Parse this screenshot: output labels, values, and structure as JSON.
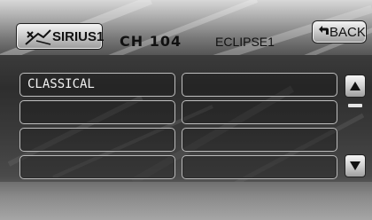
{
  "header": {
    "source_button": {
      "label": "SIRIUS1",
      "icon": "sirius-logo-icon"
    },
    "channel": "CH 104",
    "station_name": "ECLIPSE1",
    "back_button": {
      "label": "BACK",
      "icon": "return-arrow-icon"
    }
  },
  "presets": {
    "items": [
      {
        "label": "CLASSICAL"
      },
      {
        "label": ""
      },
      {
        "label": ""
      },
      {
        "label": ""
      },
      {
        "label": ""
      },
      {
        "label": ""
      },
      {
        "label": ""
      },
      {
        "label": ""
      }
    ]
  },
  "scroll": {
    "up_icon": "triangle-up-icon",
    "down_icon": "triangle-down-icon",
    "position_fraction": 0.0
  },
  "colors": {
    "panel": "#2e2e2e",
    "button_face": "#d0d0d0",
    "preset_border": "#bdbdbd",
    "text_light": "#f2f2f2"
  }
}
